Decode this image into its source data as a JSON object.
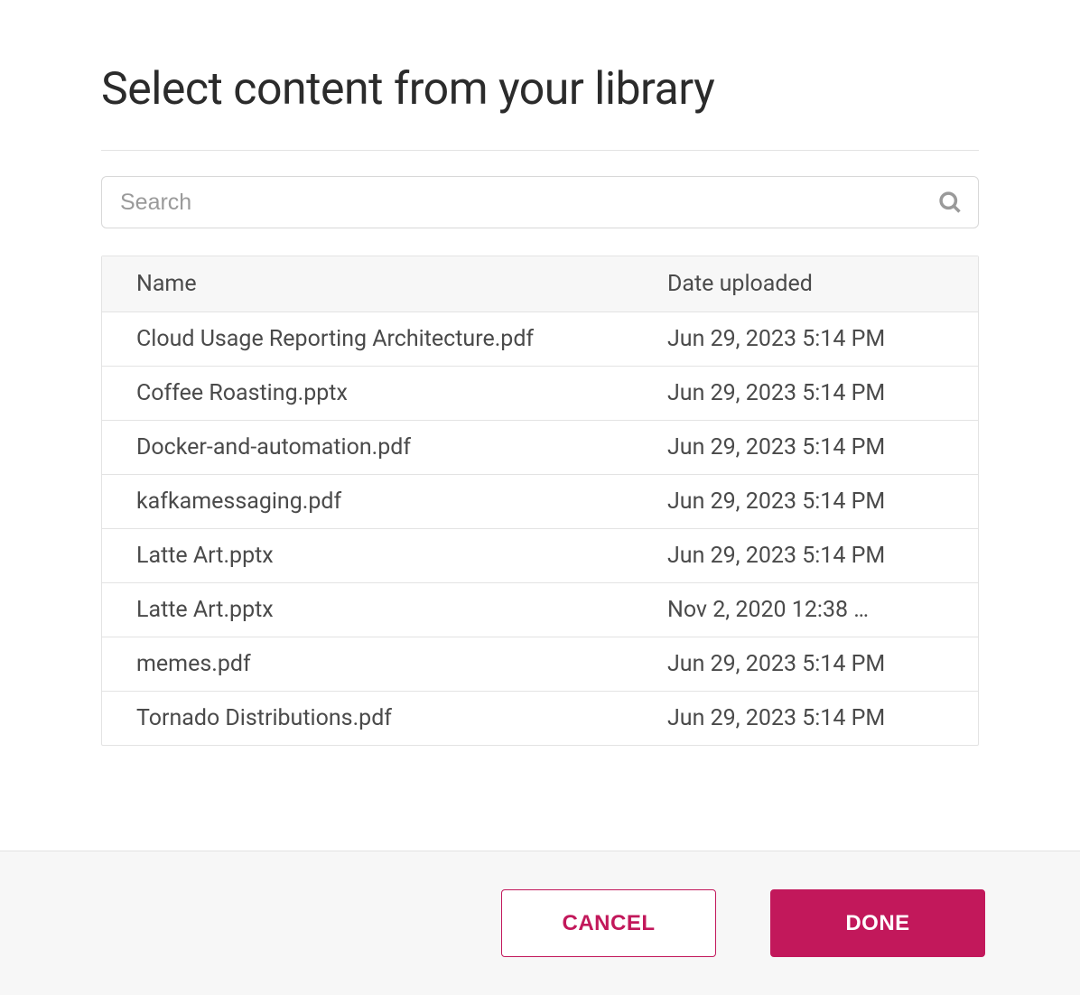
{
  "modal": {
    "title": "Select content from your library"
  },
  "search": {
    "placeholder": "Search"
  },
  "table": {
    "headers": {
      "name": "Name",
      "date": "Date uploaded"
    },
    "rows": [
      {
        "name": "Cloud Usage Reporting Architecture.pdf",
        "date": "Jun 29, 2023 5:14 PM"
      },
      {
        "name": "Coffee Roasting.pptx",
        "date": "Jun 29, 2023 5:14 PM"
      },
      {
        "name": "Docker-and-automation.pdf",
        "date": "Jun 29, 2023 5:14 PM"
      },
      {
        "name": "kafkamessaging.pdf",
        "date": "Jun 29, 2023 5:14 PM"
      },
      {
        "name": "Latte Art.pptx",
        "date": "Jun 29, 2023 5:14 PM"
      },
      {
        "name": "Latte Art.pptx",
        "date": "Nov 2, 2020 12:38 …"
      },
      {
        "name": "memes.pdf",
        "date": "Jun 29, 2023 5:14 PM"
      },
      {
        "name": "Tornado Distributions.pdf",
        "date": "Jun 29, 2023 5:14 PM"
      }
    ]
  },
  "footer": {
    "cancel_label": "CANCEL",
    "done_label": "DONE"
  }
}
